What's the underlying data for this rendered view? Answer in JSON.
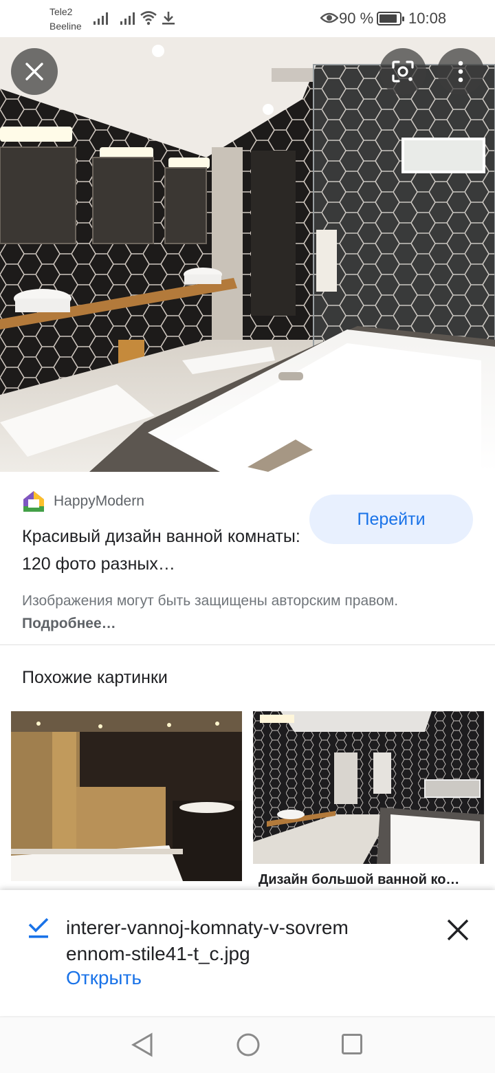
{
  "status_bar": {
    "carrier1": "Tele2",
    "carrier2": "Beeline",
    "battery_percent": "90 %",
    "battery_level": 0.9,
    "time": "10:08",
    "icons": [
      "signal-icon",
      "signal-icon",
      "wifi-icon",
      "download-icon",
      "eye-comfort-icon",
      "battery-icon"
    ]
  },
  "viewer": {
    "close_icon": "close-icon",
    "lens_icon": "google-lens-icon",
    "more_icon": "more-vert-icon"
  },
  "result": {
    "site_name": "HappyModern",
    "title": "Красивый дизайн ванной комнаты: 120 фото разных…",
    "go_button": "Перейти",
    "copyright_text": "Изображения могут быть защищены авторским правом.",
    "copyright_more": "Подробнее…"
  },
  "similar": {
    "heading": "Похожие картинки",
    "items": [
      {
        "caption": ""
      },
      {
        "caption": "Дизайн большой ванной ко…"
      }
    ]
  },
  "download": {
    "filename": "interer-vannoj-komnaty-v-sovremennom-stile41-t_c.jpg",
    "open_label": "Открыть",
    "check_icon": "check-icon",
    "close_icon": "close-icon"
  },
  "nav": {
    "back_icon": "back-triangle-icon",
    "home_icon": "home-circle-icon",
    "recents_icon": "recents-square-icon"
  }
}
